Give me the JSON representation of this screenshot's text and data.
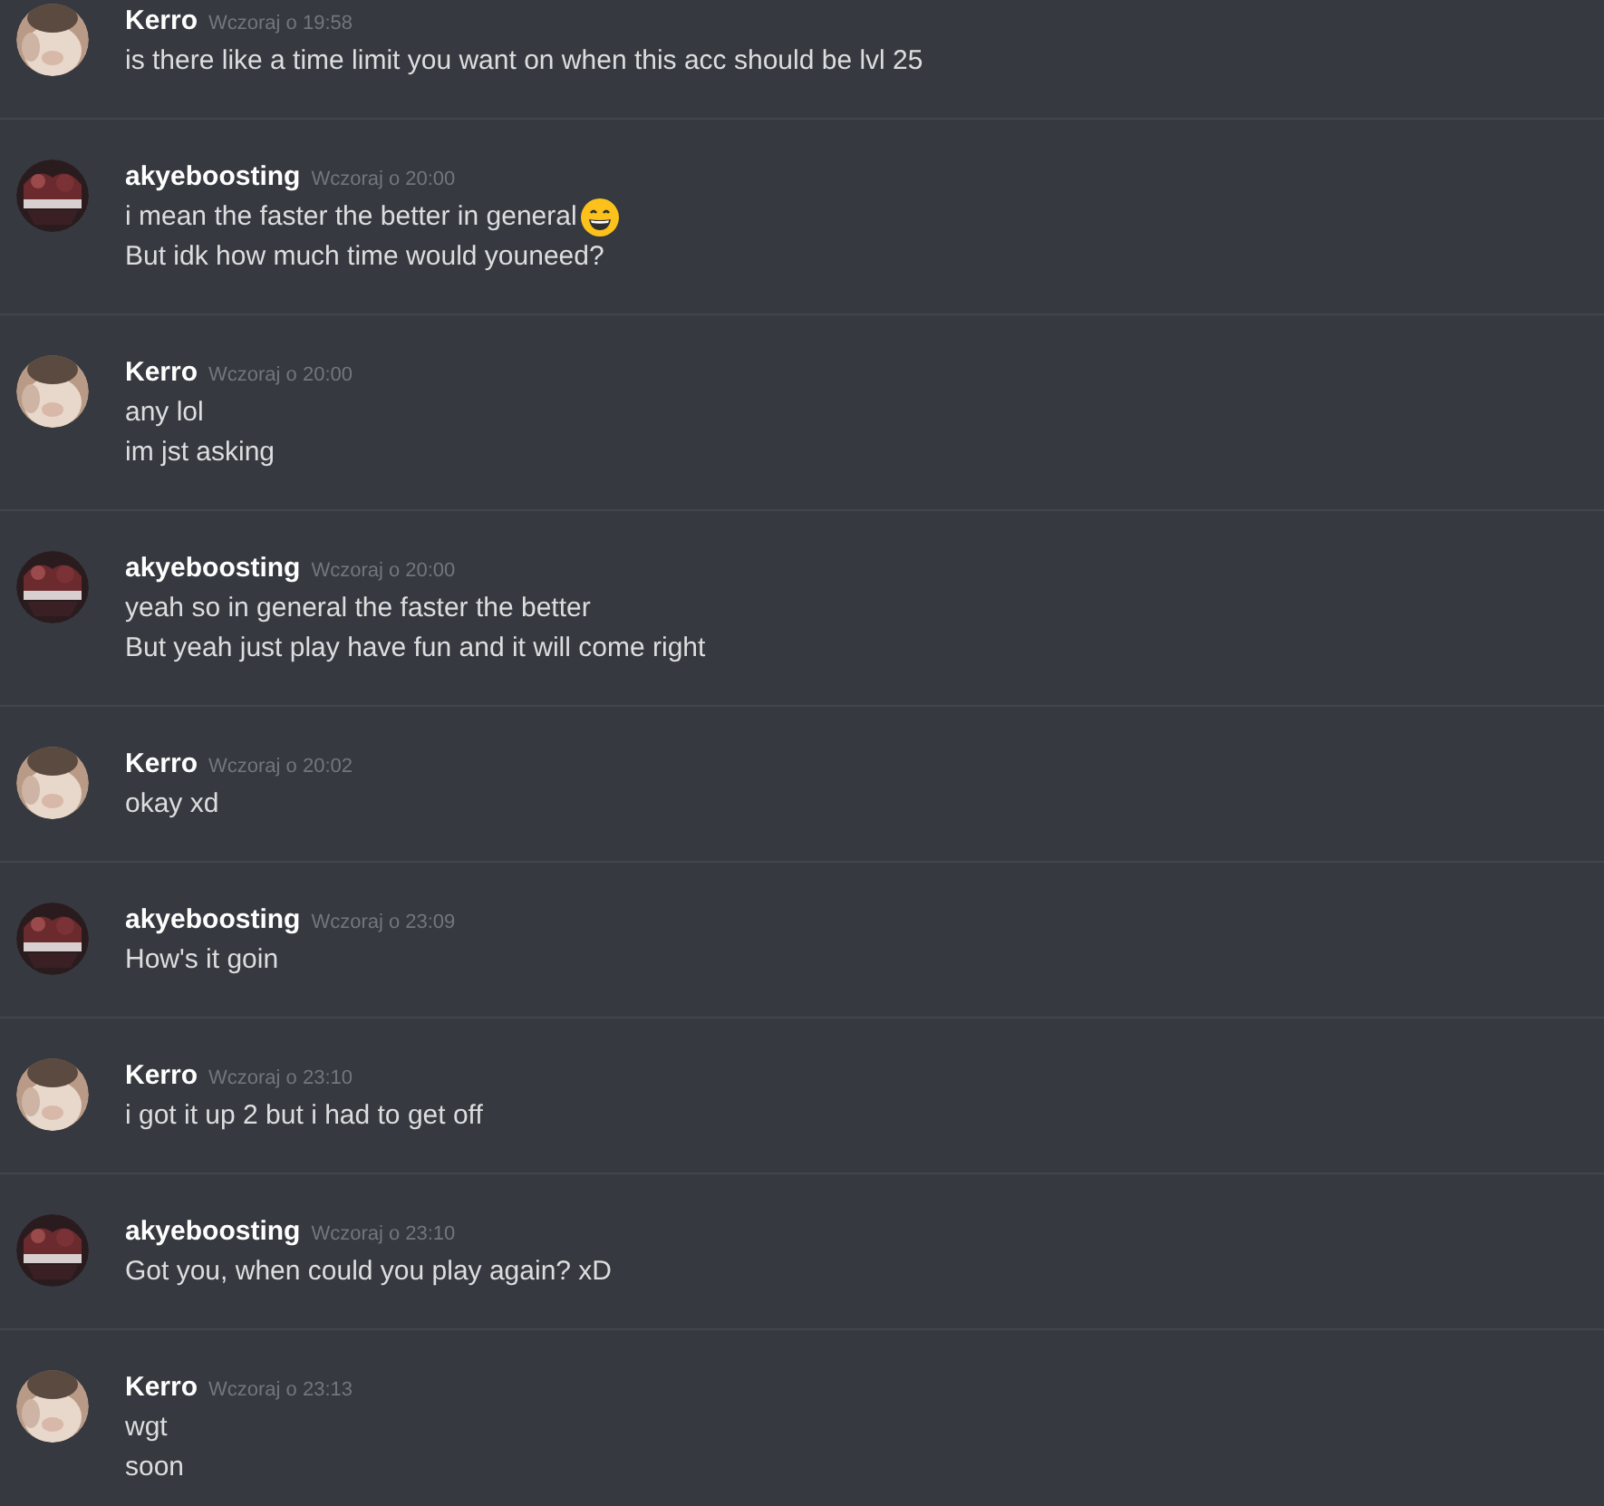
{
  "messages": [
    {
      "author": "Kerro",
      "avatar": {
        "kind": "cat"
      },
      "time": "Wczoraj o 19:58",
      "lines": [
        {
          "kind": "plain",
          "text": "is there like a time limit you want on when this acc should be lvl 25"
        }
      ]
    },
    {
      "author": "akyeboosting",
      "avatar": {
        "kind": "banner"
      },
      "time": "Wczoraj o 20:00",
      "lines": [
        {
          "kind": "emoji",
          "text": "i mean the faster the better in general"
        },
        {
          "kind": "plain",
          "text": "But idk how much time would youneed?"
        }
      ]
    },
    {
      "author": "Kerro",
      "avatar": {
        "kind": "cat"
      },
      "time": "Wczoraj o 20:00",
      "lines": [
        {
          "kind": "plain",
          "text": "any lol"
        },
        {
          "kind": "plain",
          "text": "im jst asking"
        }
      ]
    },
    {
      "author": "akyeboosting",
      "avatar": {
        "kind": "banner"
      },
      "time": "Wczoraj o 20:00",
      "lines": [
        {
          "kind": "plain",
          "text": "yeah so in general the faster the better"
        },
        {
          "kind": "plain",
          "text": "But yeah just play have fun and it will come right"
        }
      ]
    },
    {
      "author": "Kerro",
      "avatar": {
        "kind": "cat"
      },
      "time": "Wczoraj o 20:02",
      "lines": [
        {
          "kind": "plain",
          "text": "okay xd"
        }
      ]
    },
    {
      "author": "akyeboosting",
      "avatar": {
        "kind": "banner"
      },
      "time": "Wczoraj o 23:09",
      "lines": [
        {
          "kind": "plain",
          "text": "How's it goin"
        }
      ]
    },
    {
      "author": "Kerro",
      "avatar": {
        "kind": "cat"
      },
      "time": "Wczoraj o 23:10",
      "lines": [
        {
          "kind": "plain",
          "text": "i got it up 2 but i had to get off"
        }
      ]
    },
    {
      "author": "akyeboosting",
      "avatar": {
        "kind": "banner"
      },
      "time": "Wczoraj o 23:10",
      "lines": [
        {
          "kind": "plain",
          "text": "Got you, when could you play again? xD"
        }
      ]
    },
    {
      "author": "Kerro",
      "avatar": {
        "kind": "cat"
      },
      "time": "Wczoraj o 23:13",
      "lines": [
        {
          "kind": "plain",
          "text": "wgt"
        },
        {
          "kind": "plain",
          "text": "soon"
        }
      ]
    }
  ]
}
